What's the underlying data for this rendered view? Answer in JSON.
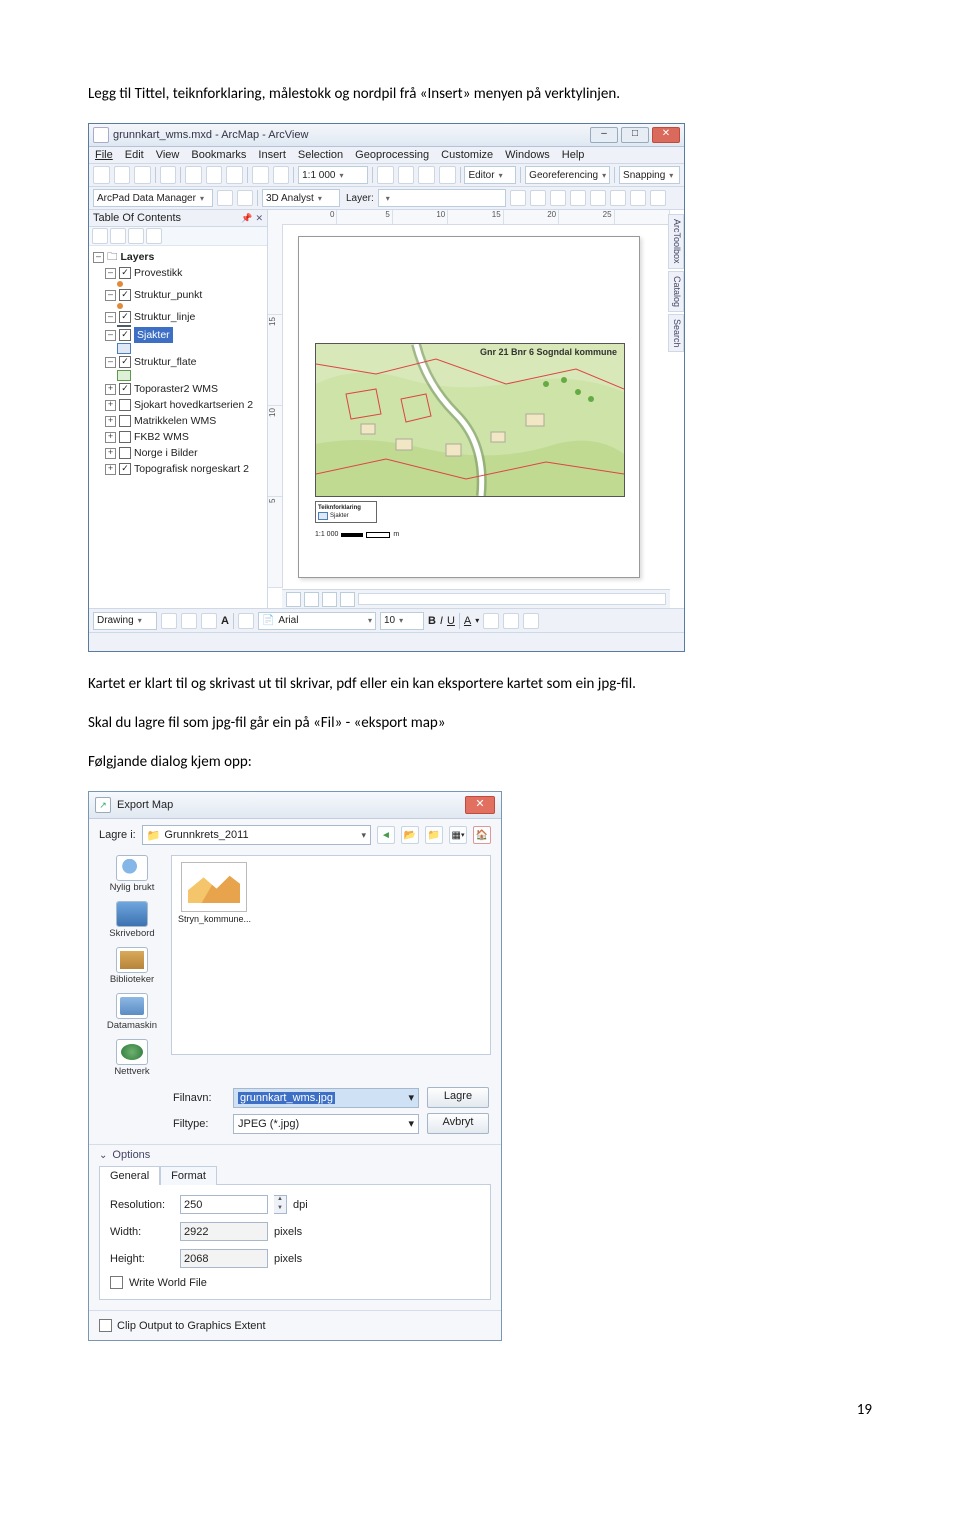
{
  "paragraphs": {
    "p1": "Legg til Tittel, teiknforklaring, målestokk og nordpil frå «Insert» menyen på verktylinjen.",
    "p2": "Kartet er klart til og skrivast ut til skrivar, pdf eller ein kan eksportere kartet som ein jpg-fil.",
    "p3": "Skal du lagre fil som jpg-fil går ein på «Fil» - «eksport map»",
    "p4": "Følgjande dialog kjem opp:"
  },
  "page_number": "19",
  "arcmap": {
    "title": "grunnkart_wms.mxd - ArcMap - ArcView",
    "menus": [
      "File",
      "Edit",
      "View",
      "Bookmarks",
      "Insert",
      "Selection",
      "Geoprocessing",
      "Customize",
      "Windows",
      "Help"
    ],
    "scale": "1:1 000",
    "editor_label": "Editor",
    "georef_label": "Georeferencing",
    "snapping_label": "Snapping",
    "arcpad_label": "ArcPad Data Manager",
    "analyst_label": "3D Analyst",
    "layer_label": "Layer:",
    "toc_title": "Table Of Contents",
    "layers_root": "Layers",
    "layers": [
      {
        "name": "Provestikk",
        "checked": true,
        "sym": "dot"
      },
      {
        "name": "Struktur_punkt",
        "checked": true,
        "sym": "dot"
      },
      {
        "name": "Struktur_linje",
        "checked": true,
        "sym": "line"
      },
      {
        "name": "Sjakter",
        "checked": true,
        "sym": "box",
        "hl": true
      },
      {
        "name": "Struktur_flate",
        "checked": true,
        "sym": "boxg"
      },
      {
        "name": "Toporaster2 WMS",
        "checked": true
      },
      {
        "name": "Sjokart hovedkartserien 2",
        "checked": false
      },
      {
        "name": "Matrikkelen WMS",
        "checked": false
      },
      {
        "name": "FKB2 WMS",
        "checked": false
      },
      {
        "name": "Norge i Bilder",
        "checked": false
      },
      {
        "name": "Topografisk norgeskart 2",
        "checked": true
      }
    ],
    "rulers_h": [
      "0",
      "5",
      "10",
      "15",
      "20",
      "25"
    ],
    "rulers_v": [
      "15",
      "10",
      "5"
    ],
    "map_title": "Gnr 21 Bnr 6 Sogndal kommune",
    "legend_title": "Teiknforklaring",
    "legend_item": "Sjakter",
    "scale_text": "1:1 000",
    "side_tabs": [
      "ArcToolbox",
      "Catalog",
      "Search"
    ],
    "drawing_label": "Drawing",
    "font_name": "Arial",
    "font_size": "10"
  },
  "export": {
    "title": "Export Map",
    "save_in_label": "Lagre i:",
    "save_in_value": "Grunnkrets_2011",
    "places": [
      "Nylig brukt",
      "Skrivebord",
      "Biblioteker",
      "Datamaskin",
      "Nettverk"
    ],
    "thumb_name": "Stryn_kommune...",
    "filename_label": "Filnavn:",
    "filename_value": "grunnkart_wms.jpg",
    "filetype_label": "Filtype:",
    "filetype_value": "JPEG (*.jpg)",
    "btn_save": "Lagre",
    "btn_cancel": "Avbryt",
    "options_label": "Options",
    "tabs": [
      "General",
      "Format"
    ],
    "resolution_label": "Resolution:",
    "resolution_value": "250",
    "resolution_unit": "dpi",
    "width_label": "Width:",
    "width_value": "2922",
    "width_unit": "pixels",
    "height_label": "Height:",
    "height_value": "2068",
    "height_unit": "pixels",
    "write_world": "Write World File",
    "clip_output": "Clip Output to Graphics Extent"
  }
}
